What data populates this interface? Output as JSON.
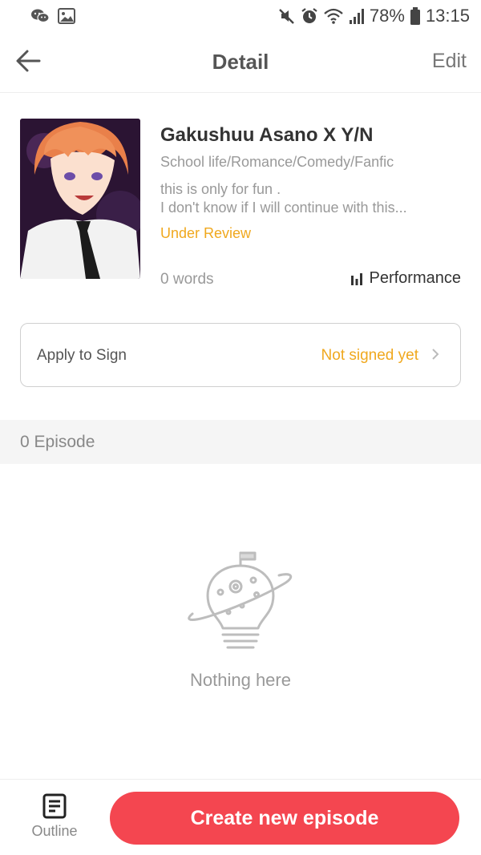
{
  "status_bar": {
    "battery": "78%",
    "time": "13:15",
    "icons": [
      "wechat-icon",
      "image-icon",
      "mute-icon",
      "alarm-icon",
      "wifi-icon",
      "signal-icon",
      "battery-icon"
    ]
  },
  "header": {
    "title": "Detail",
    "edit_label": "Edit",
    "back_icon": "arrow-left-icon"
  },
  "book": {
    "title": "Gakushuu Asano X Y/N",
    "genre": "School life/Romance/Comedy/Fanfic",
    "description_line1": "this is only for fun .",
    "description_line2": "I don't know if I will continue with this...",
    "status": "Under Review",
    "words": "0 words",
    "performance_label": "Performance"
  },
  "sign": {
    "label": "Apply to Sign",
    "status": "Not signed yet"
  },
  "episodes": {
    "count_label": "0 Episode",
    "empty_text": "Nothing here"
  },
  "bottom_bar": {
    "outline_label": "Outline",
    "create_label": "Create new episode"
  },
  "colors": {
    "accent_red": "#f44650",
    "status_orange": "#f0a81e",
    "text_dark": "#333333",
    "text_muted": "#999999"
  }
}
